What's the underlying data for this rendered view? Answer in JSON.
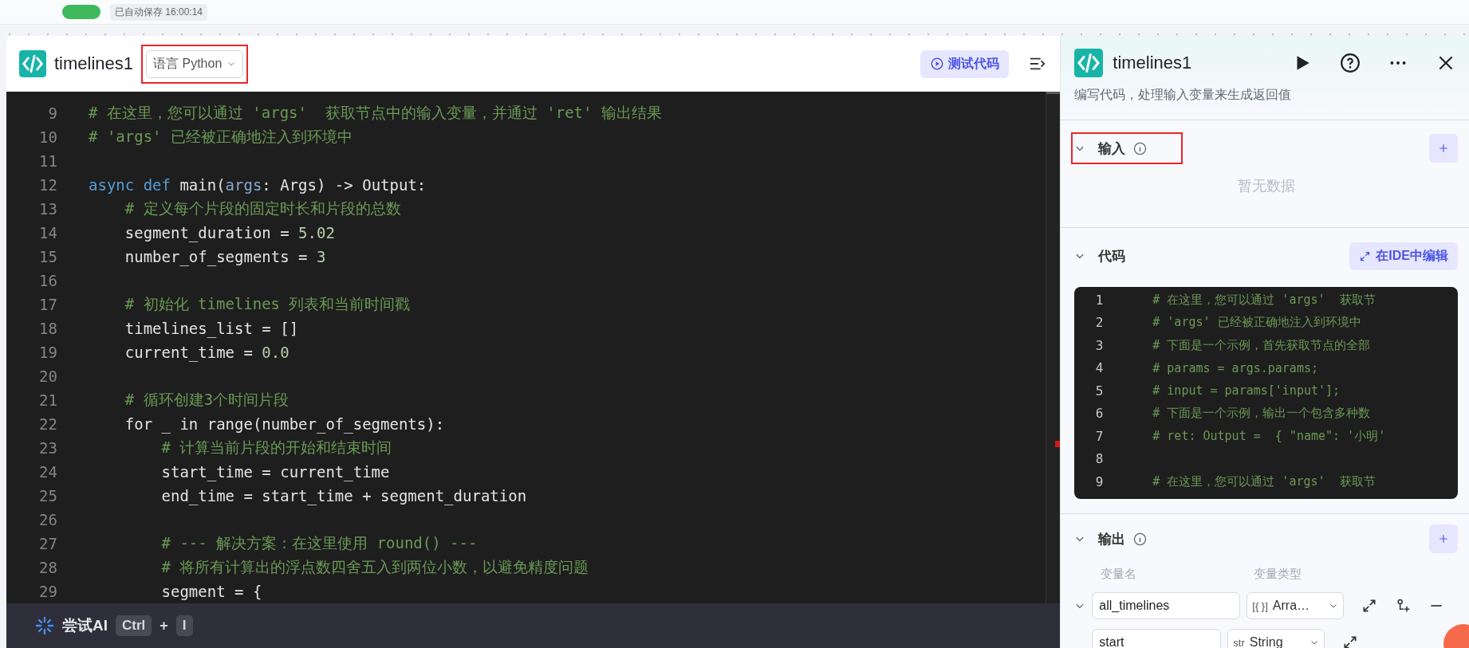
{
  "top_bar": {
    "save_status": "已自动保存 16:00:14"
  },
  "editor": {
    "title": "timelines1",
    "language_select": {
      "label": "语言 Python",
      "highlighted": true
    },
    "test_button": "测试代码",
    "lines": [
      {
        "number": "9",
        "tokens": [
          {
            "kind": "comment",
            "text": "# 在这里，您可以通过 'args'  获取节点中的输入变量，并通过 'ret' 输出结果"
          }
        ]
      },
      {
        "number": "10",
        "tokens": [
          {
            "kind": "comment",
            "text": "# 'args' 已经被正确地注入到环境中"
          }
        ]
      },
      {
        "number": "11"
      },
      {
        "number": "12",
        "tokens": [
          {
            "kind": "keyword",
            "text": "async def"
          },
          {
            "kind": "plain",
            "text": " main("
          },
          {
            "kind": "param",
            "text": "args"
          },
          {
            "kind": "plain",
            "text": ": Args) -> Output:"
          }
        ]
      },
      {
        "number": "13",
        "tokens": [
          {
            "kind": "comment",
            "text": "    # 定义每个片段的固定时长和片段的总数"
          }
        ]
      },
      {
        "number": "14",
        "tokens": [
          {
            "kind": "plain",
            "text": "    segment_duration = "
          },
          {
            "kind": "number",
            "text": "5.02"
          }
        ]
      },
      {
        "number": "15",
        "tokens": [
          {
            "kind": "plain",
            "text": "    number_of_segments = "
          },
          {
            "kind": "number",
            "text": "3"
          }
        ]
      },
      {
        "number": "16"
      },
      {
        "number": "17",
        "tokens": [
          {
            "kind": "comment",
            "text": "    # 初始化 timelines 列表和当前时间戳"
          }
        ]
      },
      {
        "number": "18",
        "tokens": [
          {
            "kind": "plain",
            "text": "    timelines_list = []"
          }
        ]
      },
      {
        "number": "19",
        "tokens": [
          {
            "kind": "plain",
            "text": "    current_time = "
          },
          {
            "kind": "number",
            "text": "0.0"
          }
        ]
      },
      {
        "number": "20"
      },
      {
        "number": "21",
        "tokens": [
          {
            "kind": "comment",
            "text": "    # 循环创建3个时间片段"
          }
        ]
      },
      {
        "number": "22",
        "tokens": [
          {
            "kind": "plain",
            "text": "    for _ in range(number_of_segments):"
          }
        ]
      },
      {
        "number": "23",
        "tokens": [
          {
            "kind": "comment",
            "text": "        # 计算当前片段的开始和结束时间"
          }
        ]
      },
      {
        "number": "24",
        "tokens": [
          {
            "kind": "plain",
            "text": "        start_time = current_time"
          }
        ]
      },
      {
        "number": "25",
        "tokens": [
          {
            "kind": "plain",
            "text": "        end_time = start_time + segment_duration"
          }
        ]
      },
      {
        "number": "26"
      },
      {
        "number": "27",
        "tokens": [
          {
            "kind": "comment",
            "text": "        # --- 解决方案：在这里使用 round() ---"
          }
        ]
      },
      {
        "number": "28",
        "tokens": [
          {
            "kind": "comment",
            "text": "        # 将所有计算出的浮点数四舍五入到两位小数，以避免精度问题"
          }
        ]
      },
      {
        "number": "29",
        "tokens": [
          {
            "kind": "plain",
            "text": "        segment = {"
          }
        ]
      }
    ]
  },
  "ai_bar": {
    "label": "尝试AI",
    "keys": [
      "Ctrl",
      "I"
    ],
    "separator": "+"
  },
  "panel": {
    "title": "timelines1",
    "description": "编写代码，处理输入变量来生成返回值",
    "input": {
      "title": "输入",
      "expanded": true,
      "highlighted": true,
      "empty_text": "暂无数据"
    },
    "code": {
      "title": "代码",
      "expanded": true,
      "ide_button": "在IDE中编辑",
      "lines": [
        {
          "number": "1",
          "text": "# 在这里，您可以通过 'args'  获取节"
        },
        {
          "number": "2",
          "text": "# 'args' 已经被正确地注入到环境中"
        },
        {
          "number": "3",
          "text": "# 下面是一个示例，首先获取节点的全部"
        },
        {
          "number": "4",
          "text": "# params = args.params;"
        },
        {
          "number": "5",
          "text": "# input = params['input'];"
        },
        {
          "number": "6",
          "text": "# 下面是一个示例，输出一个包含多种数"
        },
        {
          "number": "7",
          "text": "# ret: Output =  { \"name\": '小明'"
        },
        {
          "number": "8"
        },
        {
          "number": "9",
          "text": "# 在这里，您可以通过 'args'  获取节"
        }
      ]
    },
    "output": {
      "title": "输出",
      "expanded": true,
      "columns": [
        "变量名",
        "变量类型"
      ],
      "rows": [
        {
          "name": "all_timelines",
          "type_icon": "[{ }]",
          "type": "Arra…",
          "expanded": true,
          "children": [
            {
              "name": "start",
              "type_icon": "str",
              "type": "String"
            }
          ]
        }
      ]
    }
  }
}
